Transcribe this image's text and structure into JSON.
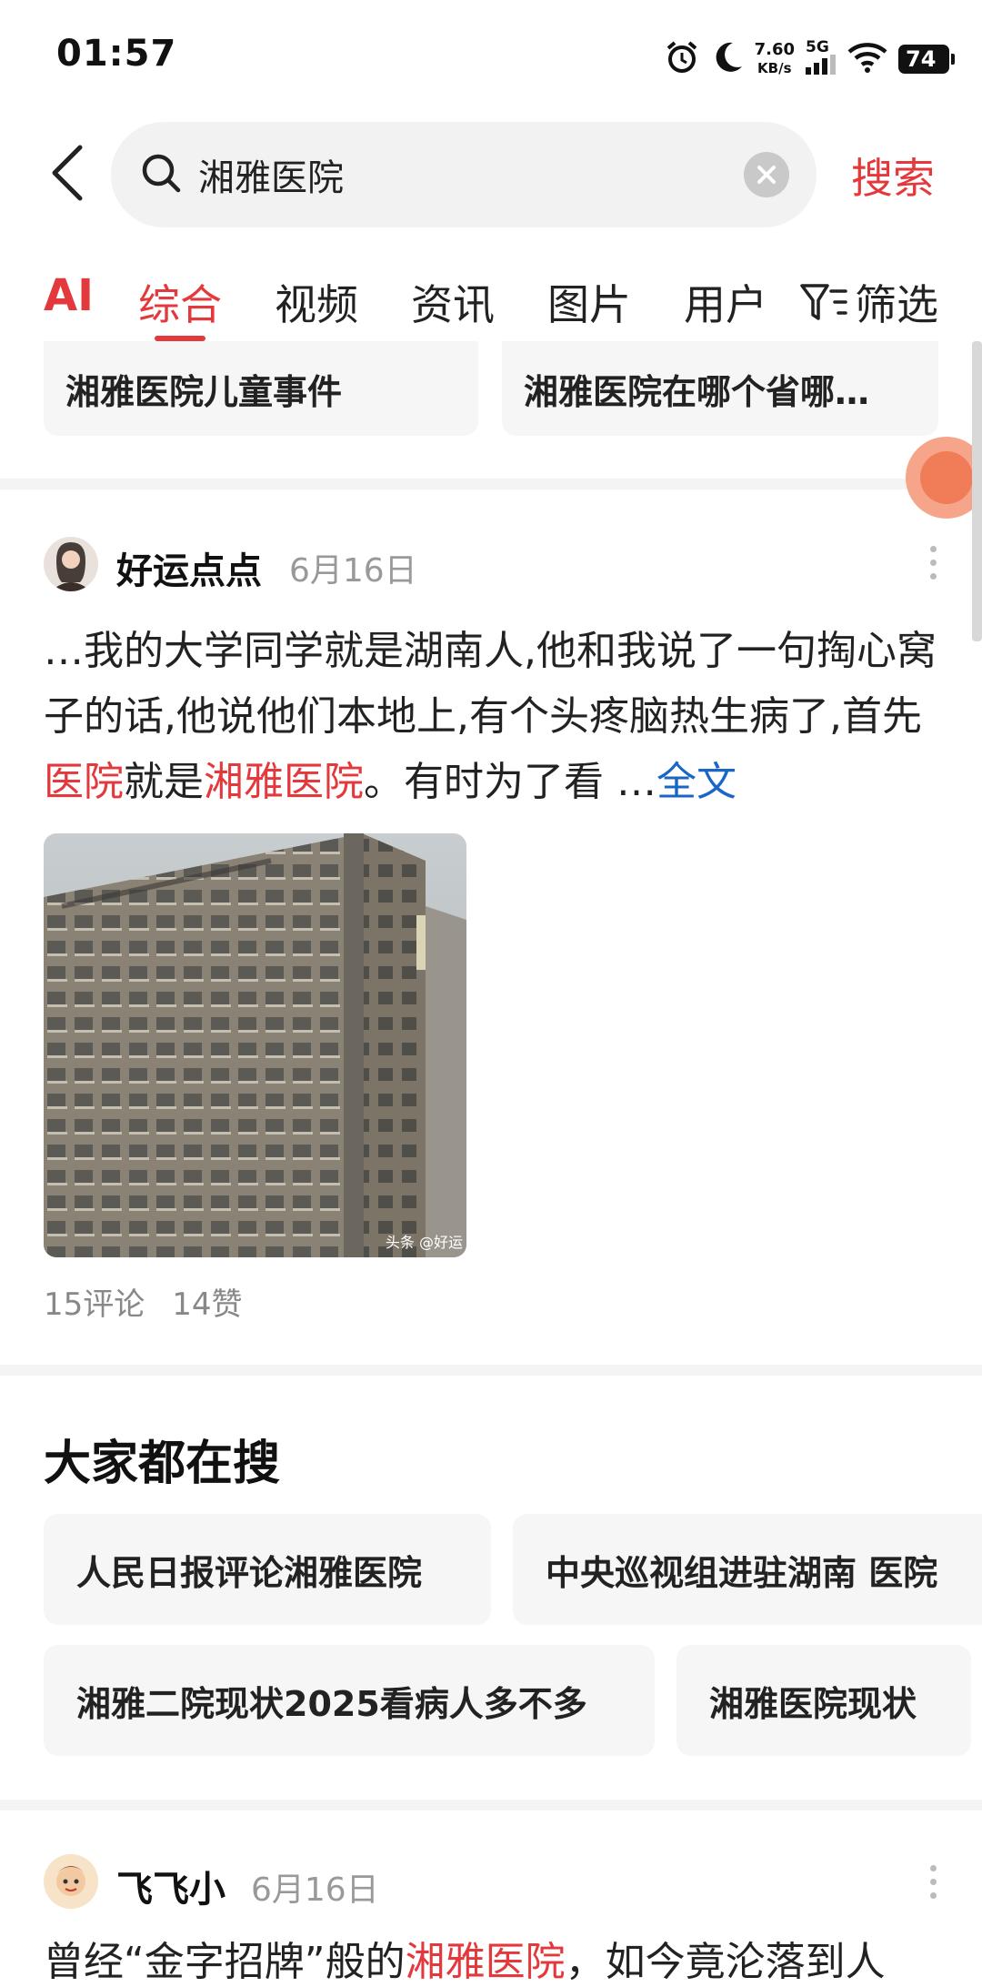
{
  "status_bar": {
    "time": "01:57",
    "net_speed_value": "7.60",
    "net_speed_unit": "KB/s",
    "network": "5G",
    "battery": "74",
    "icons": [
      "alarm-icon",
      "moon-icon",
      "signal-icon",
      "wifi-icon",
      "battery-icon"
    ]
  },
  "header": {
    "search_query": "湘雅医院",
    "search_button": "搜索",
    "icons": [
      "back-icon",
      "search-icon",
      "clear-icon"
    ]
  },
  "tabs": {
    "items": [
      {
        "label": "AI"
      },
      {
        "label": "综合",
        "active": true
      },
      {
        "label": "视频"
      },
      {
        "label": "资讯"
      },
      {
        "label": "图片"
      },
      {
        "label": "用户"
      }
    ],
    "filter_label": "筛选"
  },
  "suggestions": [
    "湘雅医院儿童事件",
    "湘雅医院在哪个省哪…"
  ],
  "post1": {
    "author": "好运点点",
    "date": "6月16日",
    "body_parts": [
      "…我的大学同学就是湖南人,他和我说了一句掏心窝子的话,他说他们本地上,有个头疼脑热生病了,首先",
      "医院",
      "就是",
      "湘雅医院",
      "。有时为了看 …"
    ],
    "full_text_link": "全文",
    "image_watermark": "头条 @好运",
    "comments": "15评论",
    "likes": "14赞"
  },
  "hot_searches": {
    "title": "大家都在搜",
    "items": [
      "人民日报评论湘雅医院",
      "中央巡视组进驻湖南 医院",
      "湘雅二院现状2025看病人多不多",
      "湘雅医院现状"
    ]
  },
  "post2": {
    "author": "飞飞小",
    "date": "6月16日",
    "body_parts": [
      "曾经“金字招牌”般的",
      "湘雅医院",
      "，如今竟沦落到人"
    ]
  },
  "colors": {
    "accent": "#e4393c",
    "link": "#1a66c6",
    "muted": "#999999"
  }
}
